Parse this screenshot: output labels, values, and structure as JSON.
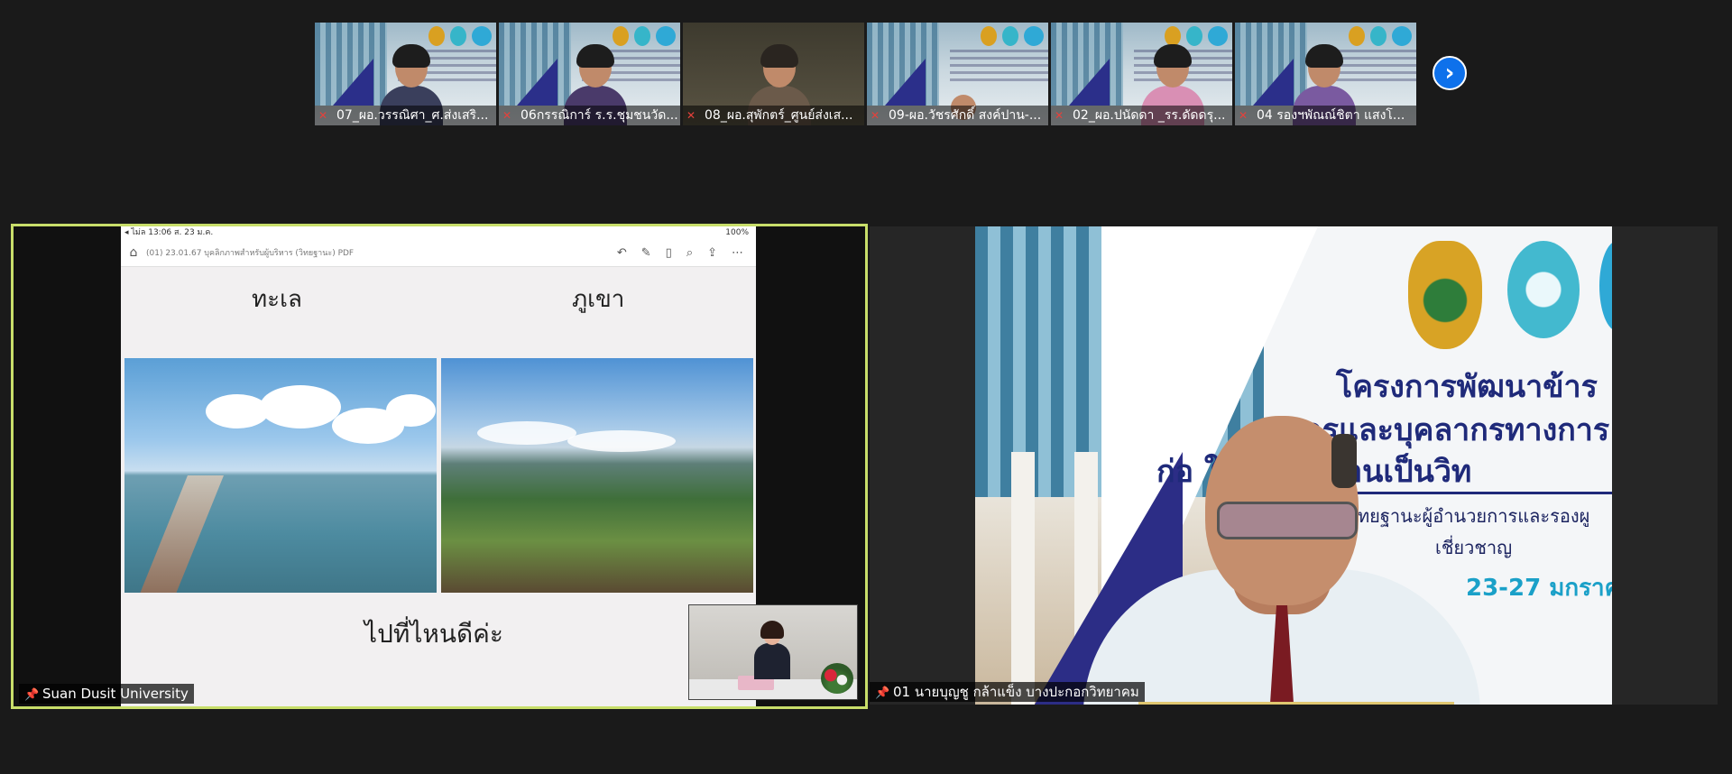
{
  "gallery": {
    "participants": [
      {
        "name": "07_ผอ.วรรณิศา_ศ.ส่งเสริ...",
        "muted": true
      },
      {
        "name": "06กรรณิการ์ ร.ร.ชุมชนวัด...",
        "muted": true
      },
      {
        "name": "08_ผอ.สุพักตร์_ศูนย์ส่งเส...",
        "muted": true
      },
      {
        "name": "09-ผอ.วัชรศักดิ์ สงค์ปาน-...",
        "muted": true
      },
      {
        "name": "02_ผอ.ปนัดดา _รร.ดัดดรุ...",
        "muted": true
      },
      {
        "name": "04 รองฯพัณณ์ชิตา  แสงโ...",
        "muted": true
      }
    ],
    "next_icon": "chevron-right-icon"
  },
  "left_tile": {
    "name": "Suan Dusit University",
    "pinned": true,
    "screen": {
      "status_left": "◂ ไม่ล   13:06   ส. 23 ม.ค.",
      "status_right": "100%",
      "document_title": "(01) 23.01.67 บุคลิกภาพสำหรับผู้บริหาร (วิทยฐานะ)  PDF",
      "heading_left": "ทะเล",
      "heading_right": "ภูเขา",
      "question": "ไปที่ไหนดีค่ะ"
    }
  },
  "right_tile": {
    "name": "01 นายบุญชู กล้าแข็ง บางปะกอกวิทยาคม",
    "pinned": true,
    "banner": {
      "line1": "โครงการพัฒนาข้าร",
      "line2": "ครูและบุคลากรทางการ",
      "line3": "ก่อ        ให้มีและเลื่อนเป็นวิท",
      "line4": "รวิทยฐานะผู้อำนวยการและรองผู",
      "line5": "เชี่ยวชาญ",
      "line6": "23-27 มกราค"
    }
  },
  "colors": {
    "active_speaker_border": "#c8de6a",
    "mic_off": "#e5413b",
    "next_button": "#0e71eb"
  }
}
